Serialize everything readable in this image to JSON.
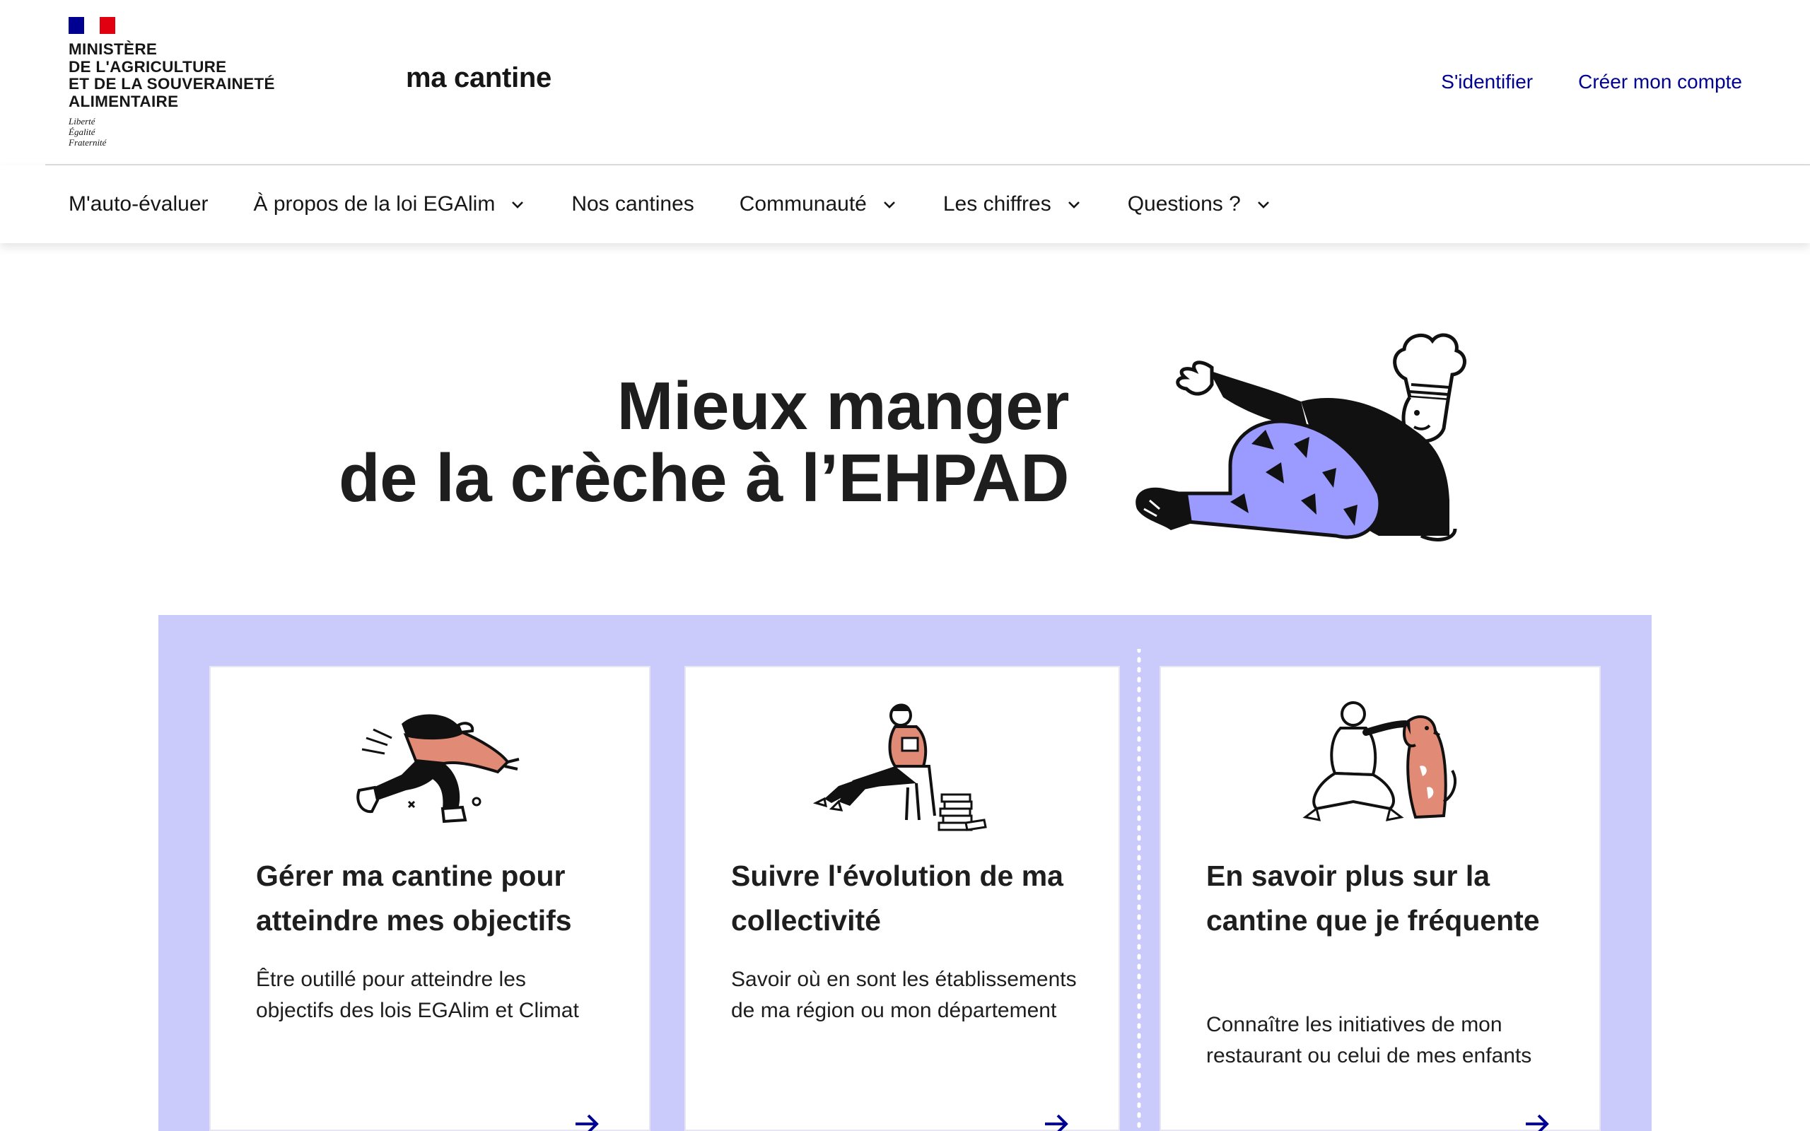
{
  "header": {
    "ministry_lines": [
      "Ministère",
      "de l'Agriculture",
      "et de la Souveraineté",
      "alimentaire"
    ],
    "motto_lines": [
      "Liberté",
      "Égalité",
      "Fraternité"
    ],
    "site_name": "ma cantine",
    "links": [
      "S'identifier",
      "Créer mon compte"
    ],
    "flag_colors": [
      "#000091",
      "#ffffff",
      "#e1000f"
    ]
  },
  "nav": {
    "items": [
      {
        "label": "M'auto-évaluer",
        "has_dropdown": false
      },
      {
        "label": "À propos de la loi EGAlim",
        "has_dropdown": true
      },
      {
        "label": "Nos cantines",
        "has_dropdown": false
      },
      {
        "label": "Communauté",
        "has_dropdown": true
      },
      {
        "label": "Les chiffres",
        "has_dropdown": true
      },
      {
        "label": "Questions ?",
        "has_dropdown": true
      }
    ]
  },
  "hero": {
    "title_line1": "Mieux manger",
    "title_line2": "de la crèche à l’EHPAD"
  },
  "cards": [
    {
      "title": "Gérer ma cantine pour atteindre mes objectifs",
      "description": "Être outillé pour atteindre les objectifs des lois EGAlim et Climat",
      "icon": "arrow-right-icon"
    },
    {
      "title": "Suivre l'évolution de ma collectivité",
      "description": "Savoir où en sont les établissements de ma région ou mon département",
      "icon": "arrow-right-icon"
    },
    {
      "title": "En savoir plus sur la cantine que je fréquente",
      "description": "Connaître les initiatives de mon restaurant ou celui de mes enfants",
      "icon": "arrow-right-icon"
    }
  ],
  "colors": {
    "accent_blue": "#000091",
    "band_lavender": "#cacafb",
    "illustration_purple": "#9a9aff",
    "illustration_coral": "#e18b76"
  }
}
